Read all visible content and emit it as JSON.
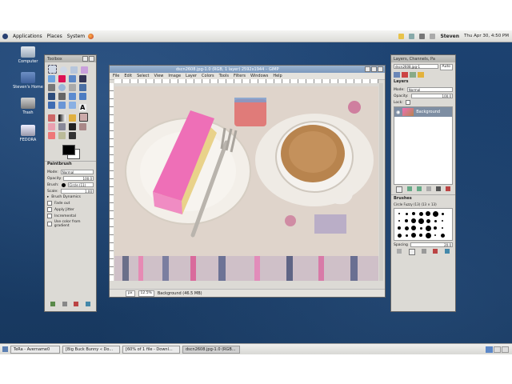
{
  "panel_top": {
    "menus": [
      "Applications",
      "Places",
      "System"
    ],
    "user": "Steven",
    "clock": "Thu Apr 30,  4:50 PM"
  },
  "desktop_icons": [
    {
      "label": "Computer"
    },
    {
      "label": "Steven's Home"
    },
    {
      "label": "Trash"
    },
    {
      "label": "FEDORA"
    }
  ],
  "toolbox": {
    "title": "Toolbox",
    "section": "Paintbrush",
    "mode_label": "Mode:",
    "mode_value": "Normal",
    "opacity_label": "Opacity",
    "opacity_value": "100.0",
    "brush_label": "Brush:",
    "brush_value": "Circle (11)",
    "scale_label": "Scale:",
    "scale_value": "1.00",
    "brush_dynamics": "Brush Dynamics",
    "options": [
      "Fade out",
      "Apply Jitter",
      "Incremental",
      "Use color from gradient"
    ]
  },
  "image_window": {
    "title": "dscn2608.jpg-1.0 (RGB, 1 layer) 2592x1944 – GIMP",
    "menus": [
      "File",
      "Edit",
      "Select",
      "View",
      "Image",
      "Layer",
      "Colors",
      "Tools",
      "Filters",
      "Windows",
      "Help"
    ],
    "unit": "px",
    "zoom": "12.5%",
    "status": "Background (46.5 MB)"
  },
  "layers_dock": {
    "title": "Layers, Channels, Pa",
    "image_select": "dscn2608.jpg-1",
    "auto": "Auto",
    "section": "Layers",
    "mode_label": "Mode:",
    "mode_value": "Normal",
    "opacity_label": "Opacity:",
    "opacity_value": "100.0",
    "lock_label": "Lock:",
    "layer_name": "Background",
    "brushes_section": "Brushes",
    "brush_info": "Circle Fuzzy (13) (13 × 13)",
    "spacing_label": "Spacing",
    "spacing_value": "20.0"
  },
  "taskbar": [
    {
      "label": "TeRa - Avername0"
    },
    {
      "label": "[Big Buck Bunny « Do..."
    },
    {
      "label": "[60% of 1 file - Downl..."
    },
    {
      "label": "dscn2608.jpg-1.0 (RGB..."
    }
  ]
}
